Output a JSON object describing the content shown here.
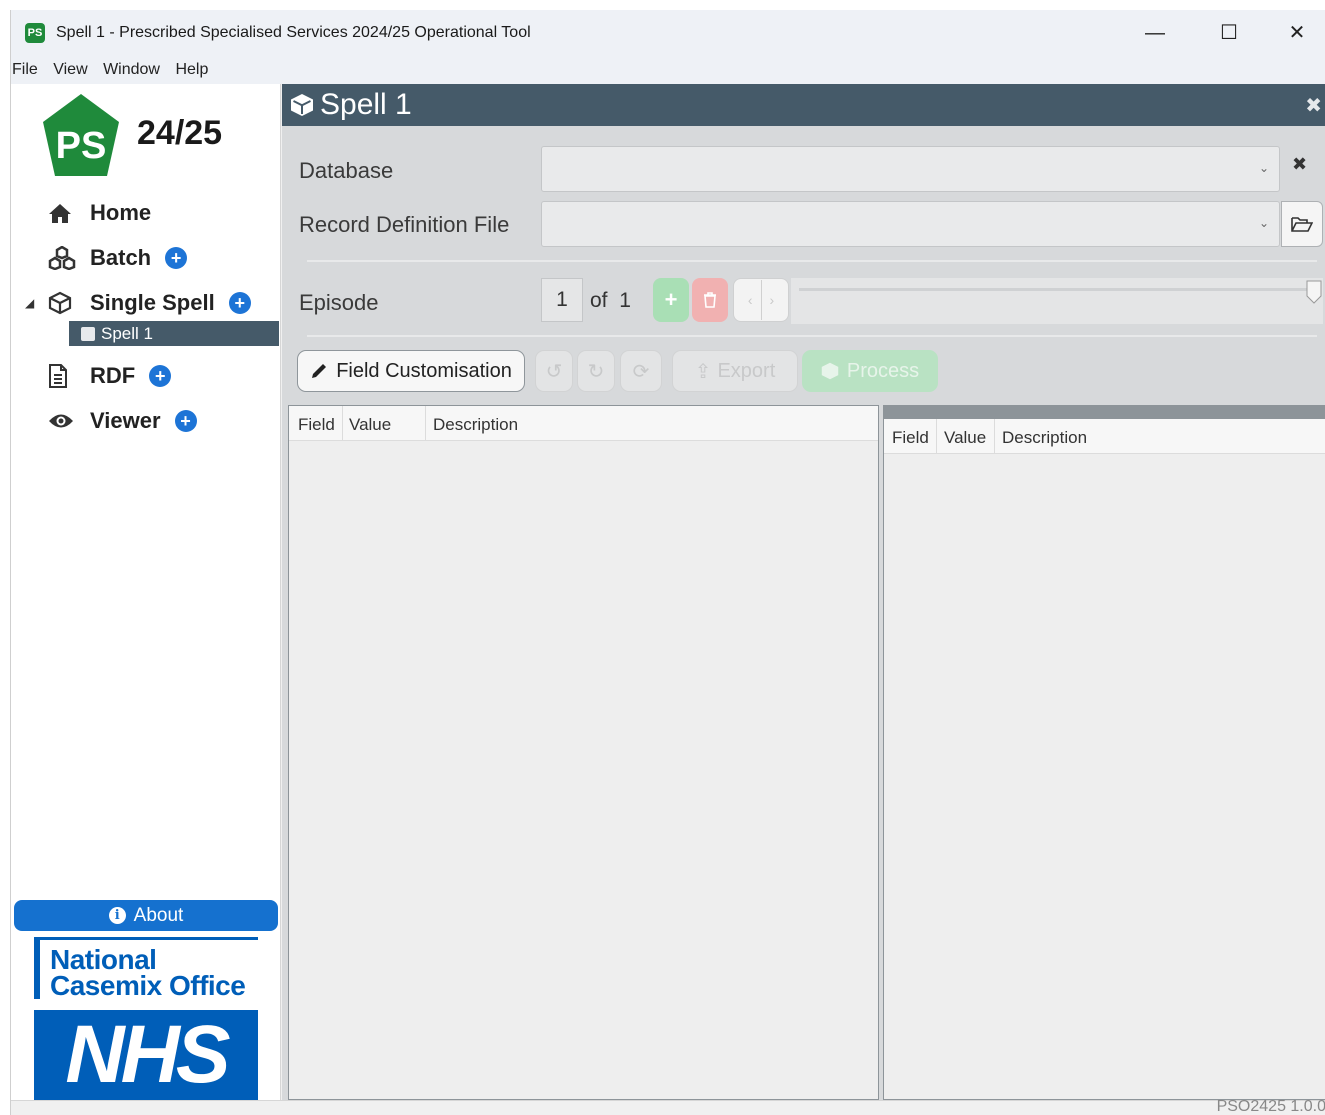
{
  "window": {
    "app_icon_text": "PS",
    "title": "Spell 1 - Prescribed Specialised Services 2024/25 Operational Tool",
    "minimize": "—",
    "maximize": "☐",
    "close": "✕"
  },
  "menu": [
    "File",
    "View",
    "Window",
    "Help"
  ],
  "sidebar": {
    "logo_letters": "PS",
    "logo_year": "24/25",
    "nav": {
      "home": "Home",
      "batch": "Batch",
      "single_spell": "Single Spell",
      "spell_child": "Spell 1",
      "rdf": "RDF",
      "viewer": "Viewer"
    },
    "about": "About",
    "nco_line1": "National",
    "nco_line2": "Casemix Office",
    "nhs": "NHS"
  },
  "panel": {
    "title": "Spell 1",
    "database_label": "Database",
    "database_value": "",
    "rdf_label": "Record Definition File",
    "rdf_value": "",
    "episode_label": "Episode",
    "episode_current": "1",
    "episode_of": "of",
    "episode_total": "1",
    "field_customisation": "Field Customisation",
    "export": "Export",
    "process": "Process"
  },
  "grid_left": {
    "columns": [
      "Field",
      "Value",
      "Description"
    ]
  },
  "grid_right": {
    "columns": [
      "Field",
      "Value",
      "Description"
    ]
  },
  "status": {
    "version": "PSO2425 1.0.0"
  },
  "colors": {
    "header_bg": "#455a69",
    "accent_blue": "#1d74d6",
    "nhs_blue": "#005eb8",
    "logo_green": "#1f8a3b",
    "add_green": "#a9dfb5",
    "delete_red": "#f1b1b1"
  }
}
